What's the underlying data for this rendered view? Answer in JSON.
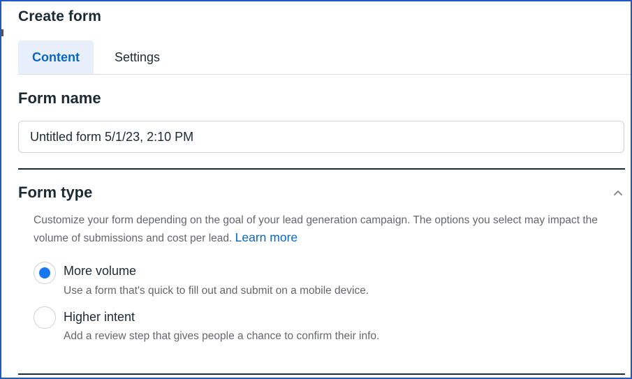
{
  "dialog": {
    "title": "Create form"
  },
  "tabs": [
    {
      "label": "Content",
      "active": true
    },
    {
      "label": "Settings",
      "active": false
    }
  ],
  "form_name": {
    "heading": "Form name",
    "value": "Untitled form 5/1/23, 2:10 PM"
  },
  "form_type": {
    "heading": "Form type",
    "expanded": true,
    "description": "Customize your form depending on the goal of your lead generation campaign. The options you select may impact the volume of submissions and cost per lead.",
    "learn_more": "Learn more",
    "options": [
      {
        "label": "More volume",
        "sublabel": "Use a form that's quick to fill out and submit on a mobile device.",
        "selected": true
      },
      {
        "label": "Higher intent",
        "sublabel": "Add a review step that gives people a chance to confirm their info.",
        "selected": false
      }
    ]
  },
  "colors": {
    "accent": "#1877f2",
    "link": "#0a66c2",
    "active_tab_bg": "#e7f0fa",
    "text_primary": "#1c2b33",
    "text_secondary": "#65676b"
  },
  "icons": {
    "collapse": "chevron-up-icon"
  }
}
